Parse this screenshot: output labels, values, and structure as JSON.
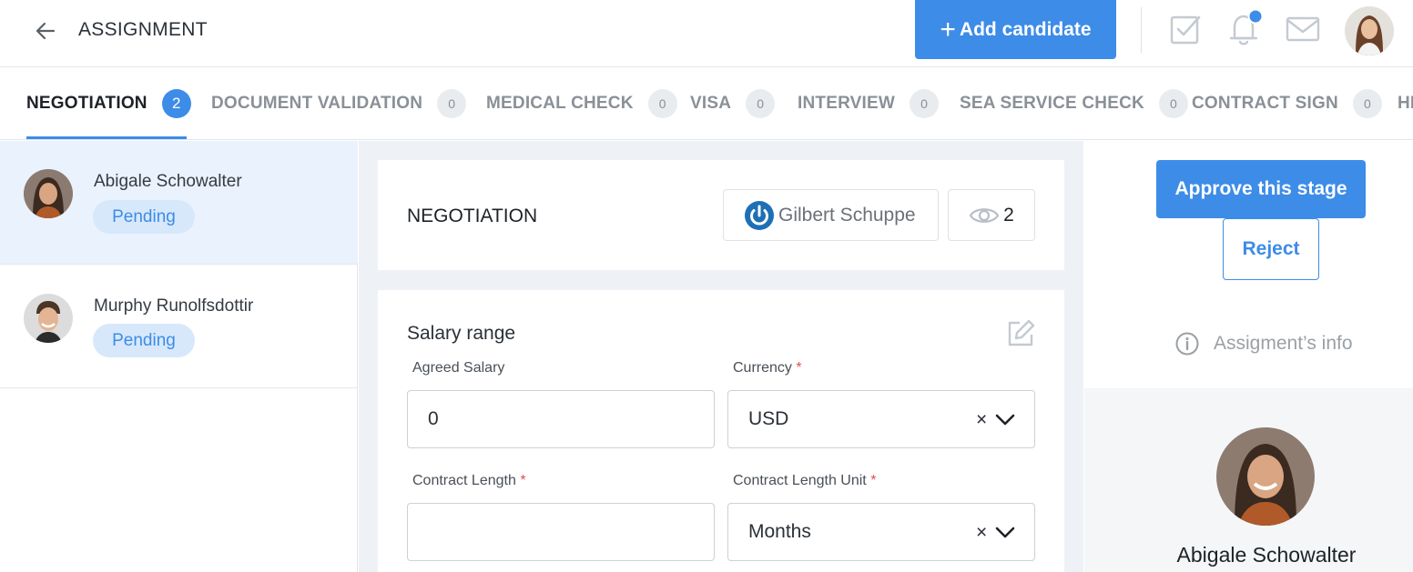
{
  "header": {
    "title": "ASSIGNMENT",
    "add_candidate_label": "Add candidate",
    "notification_dot_color": "#3d8ce8"
  },
  "tabs": [
    {
      "label": "NEGOTIATION",
      "count": "2",
      "active": true
    },
    {
      "label": "DOCUMENT VALIDATION",
      "count": "0"
    },
    {
      "label": "MEDICAL CHECK",
      "count": "0"
    },
    {
      "label": "VISA",
      "count": "0"
    },
    {
      "label": "INTERVIEW",
      "count": "0"
    },
    {
      "label": "SEA SERVICE CHECK",
      "count": "0"
    },
    {
      "label": "CONTRACT SIGN",
      "count": "0"
    },
    {
      "label": "HI"
    }
  ],
  "candidates": [
    {
      "name": "Abigale Schowalter",
      "status": "Pending",
      "selected": true
    },
    {
      "name": "Murphy Runolfsdottir",
      "status": "Pending"
    }
  ],
  "stage_card": {
    "title": "NEGOTIATION",
    "assignee": "Gilbert Schuppe",
    "views": "2"
  },
  "salary": {
    "title": "Salary range",
    "agreed_salary_label": "Agreed Salary",
    "agreed_salary_value": "0",
    "currency_label": "Currency",
    "currency_value": "USD",
    "contract_length_label": "Contract Length",
    "contract_length_value": "",
    "contract_length_unit_label": "Contract Length Unit",
    "contract_length_unit_value": "Months",
    "required_mark": "*",
    "clear_glyph": "×"
  },
  "actions": {
    "approve_label": "Approve this stage",
    "reject_label": "Reject",
    "info_label": "Assigment’s info"
  },
  "profile": {
    "name": "Abigale Schowalter"
  },
  "colors": {
    "accent": "#3d8ce8",
    "pending_bg": "#d7e8fb",
    "selected_row_bg": "#eaf2fd",
    "required": "#e0524d"
  }
}
